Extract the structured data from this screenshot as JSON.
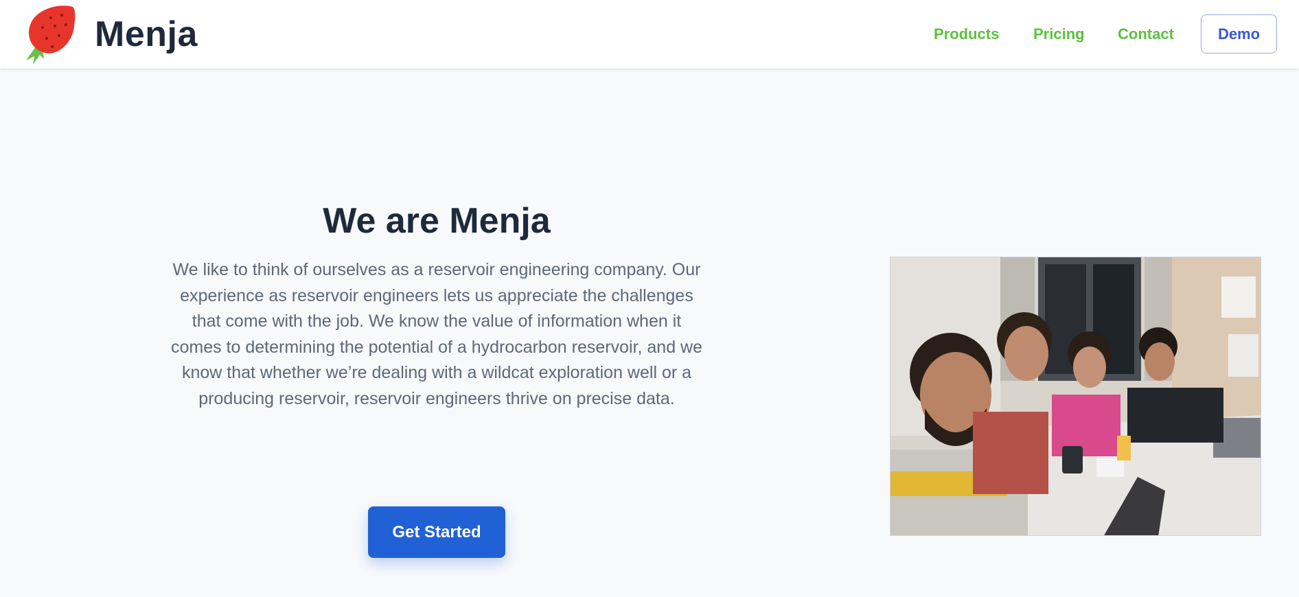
{
  "header": {
    "brand": "Menja",
    "logo_icon": "strawberry-icon",
    "nav": {
      "products": "Products",
      "pricing": "Pricing",
      "contact": "Contact"
    },
    "demo_label": "Demo"
  },
  "hero": {
    "title": "We are Menja",
    "body": "We like to think of ourselves as a reservoir engineering company. Our experience as reservoir engineers lets us appreciate the challenges that come with the job. We know the value of information when it comes to determining the potential of a hydrocarbon reservoir, and we know that whether we’re dealing with a wildcat exploration well or a producing reservoir, reservoir engineers thrive on precise data.",
    "cta_label": "Get Started"
  },
  "colors": {
    "brand_text": "#1e2a3b",
    "nav_green": "#5ac23d",
    "demo_blue": "#3a57d6",
    "cta_blue": "#2161d6",
    "page_bg": "#f7f9fb"
  }
}
